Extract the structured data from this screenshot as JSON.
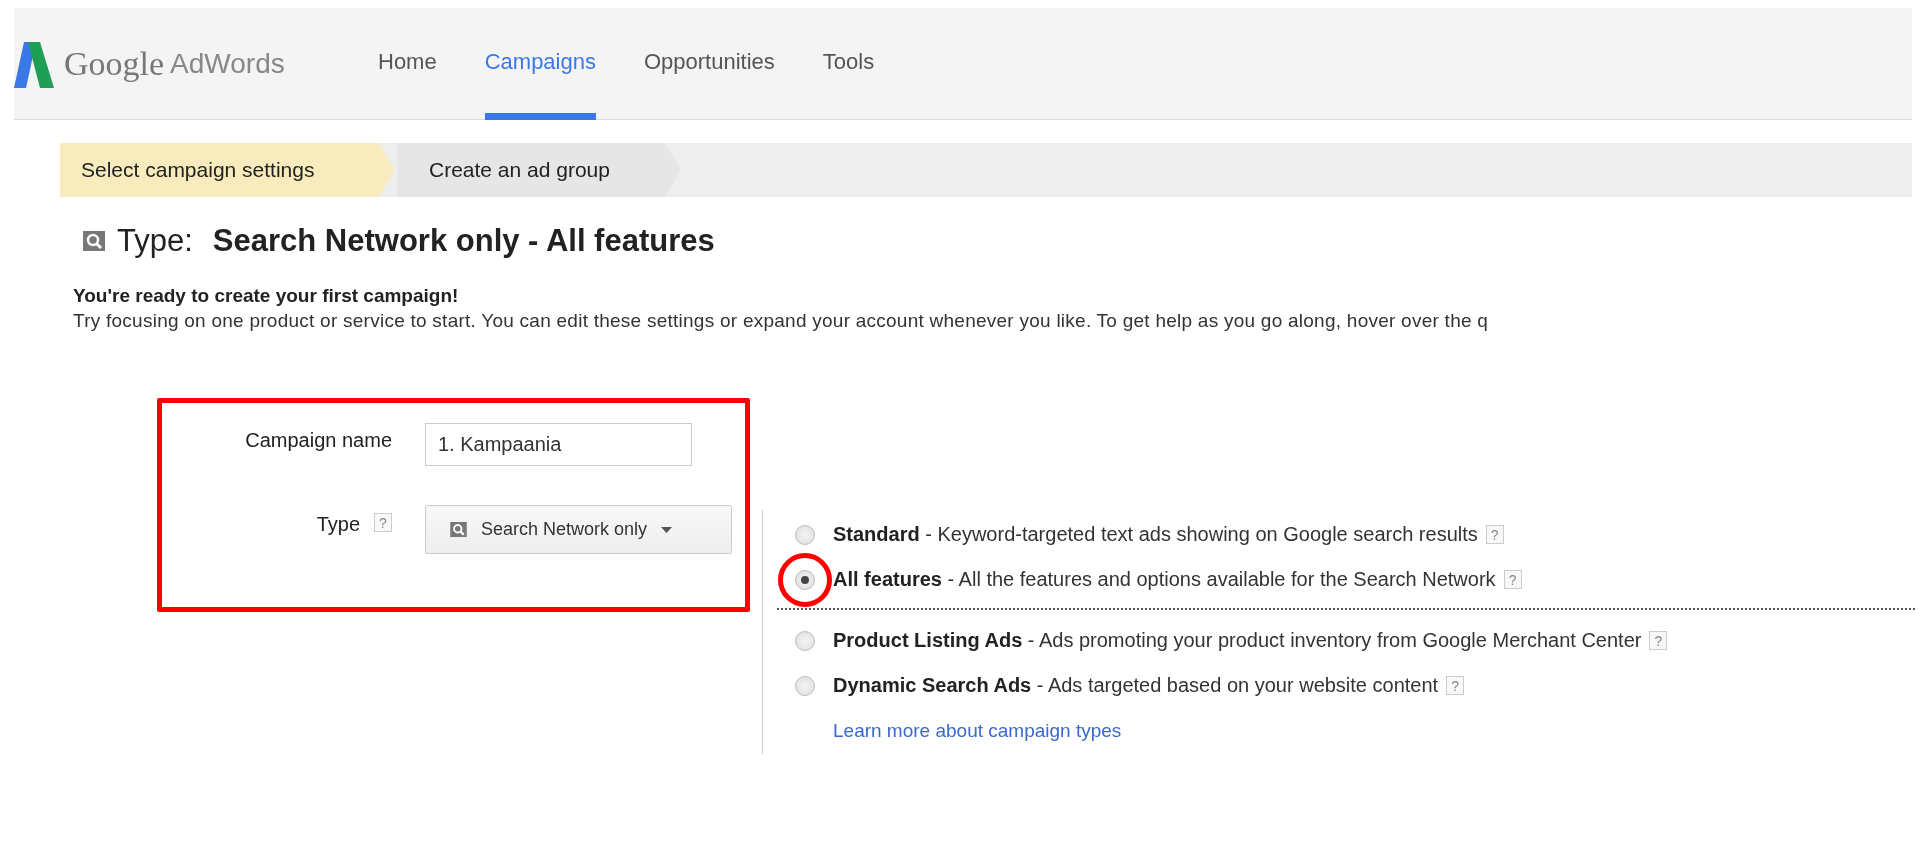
{
  "logo": {
    "brand": "Google",
    "product": "AdWords"
  },
  "nav": [
    {
      "label": "Home",
      "selected": false
    },
    {
      "label": "Campaigns",
      "selected": true
    },
    {
      "label": "Opportunities",
      "selected": false
    },
    {
      "label": "Tools",
      "selected": false
    }
  ],
  "steps": [
    {
      "label": "Select campaign settings",
      "selected": true
    },
    {
      "label": "Create an ad group",
      "selected": false
    }
  ],
  "type_heading": {
    "label": "Type:",
    "value": "Search Network only - All features"
  },
  "intro": {
    "heading": "You're ready to create your first campaign!",
    "text": "Try focusing on one product or service to start. You can edit these settings or expand your account whenever you like. To get help as you go along, hover over the q"
  },
  "form": {
    "campaign_name": {
      "label": "Campaign name",
      "value": "1. Kampaania"
    },
    "type": {
      "label": "Type",
      "help": "?",
      "dropdown": "Search Network only"
    }
  },
  "radio_groups": [
    {
      "options": [
        {
          "text": "**Standard** - Keyword-targeted text ads showing on Google search results",
          "help": "?",
          "selected": false
        },
        {
          "text": "**All features** - All the features and options available for the Search Network",
          "help": "?",
          "selected": true
        }
      ]
    },
    {
      "options": [
        {
          "text": "**Product Listing Ads** - Ads promoting your product inventory from Google Merchant Center",
          "help": "?",
          "selected": false
        },
        {
          "text": "**Dynamic Search Ads** - Ads targeted based on your website content",
          "help": "?",
          "selected": false
        }
      ]
    }
  ],
  "learn_more": "Learn more about campaign types"
}
